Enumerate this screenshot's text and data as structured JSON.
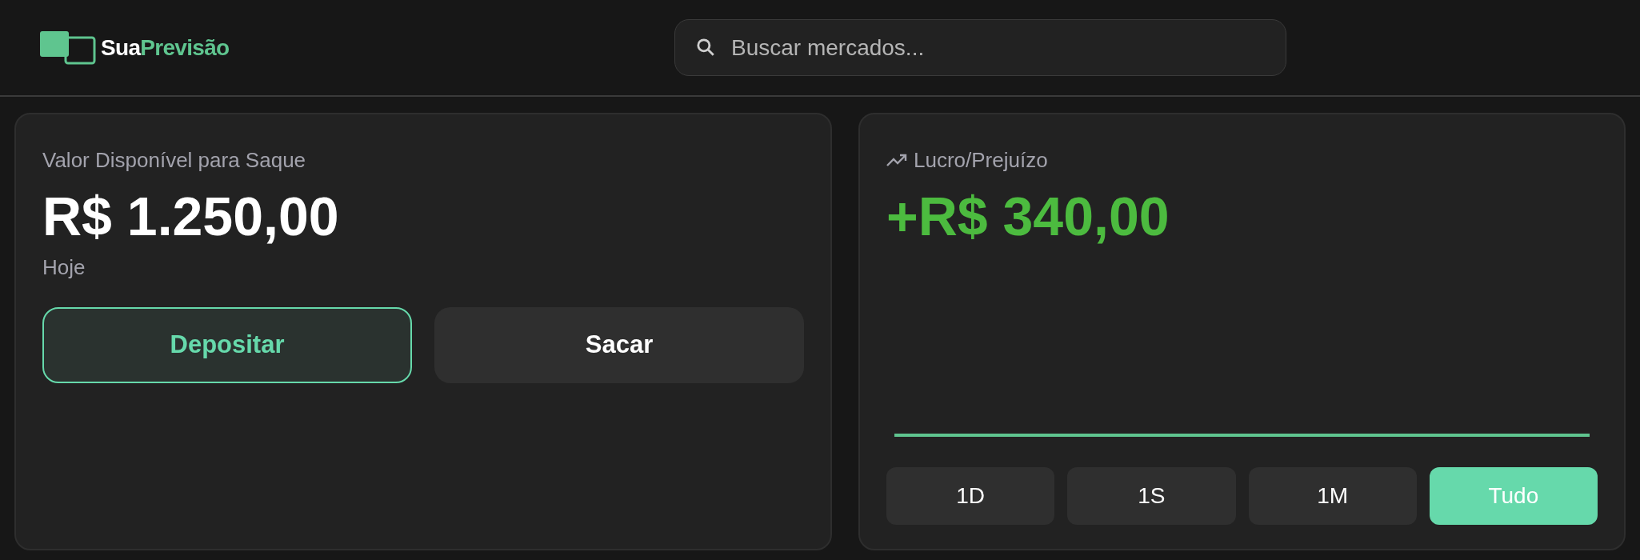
{
  "header": {
    "logo": {
      "first": "Sua",
      "second": "Previsão"
    },
    "search": {
      "placeholder": "Buscar mercados..."
    }
  },
  "balance_card": {
    "label": "Valor Disponível para Saque",
    "amount": "R$ 1.250,00",
    "period": "Hoje",
    "buttons": [
      {
        "label": "Depositar",
        "kind": "outline"
      },
      {
        "label": "Sacar",
        "kind": "solid"
      }
    ]
  },
  "profit_card": {
    "label": "Lucro/Prejuízo",
    "amount": "+R$ 340,00",
    "periods": [
      {
        "label": "1D",
        "selected": false
      },
      {
        "label": "1S",
        "selected": false
      },
      {
        "label": "1M",
        "selected": false
      },
      {
        "label": "Tudo",
        "selected": true
      }
    ]
  }
}
